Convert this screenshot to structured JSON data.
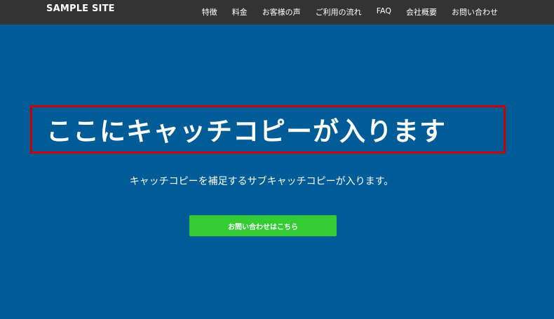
{
  "header": {
    "logo": "SAMPLE SITE",
    "nav": [
      "特徴",
      "料金",
      "お客様の声",
      "ご利用の流れ",
      "FAQ",
      "会社概要",
      "お問い合わせ"
    ]
  },
  "hero": {
    "catch_copy": "ここにキャッチコピーが入ります",
    "sub_copy": "キャッチコピーを補足するサブキャッチコピーが入ります。",
    "cta_label": "お問い合わせはこちら"
  },
  "colors": {
    "header_bg": "#333333",
    "hero_bg": "#005c97",
    "cta_bg": "#33cc33",
    "highlight_border": "#cc0000"
  }
}
